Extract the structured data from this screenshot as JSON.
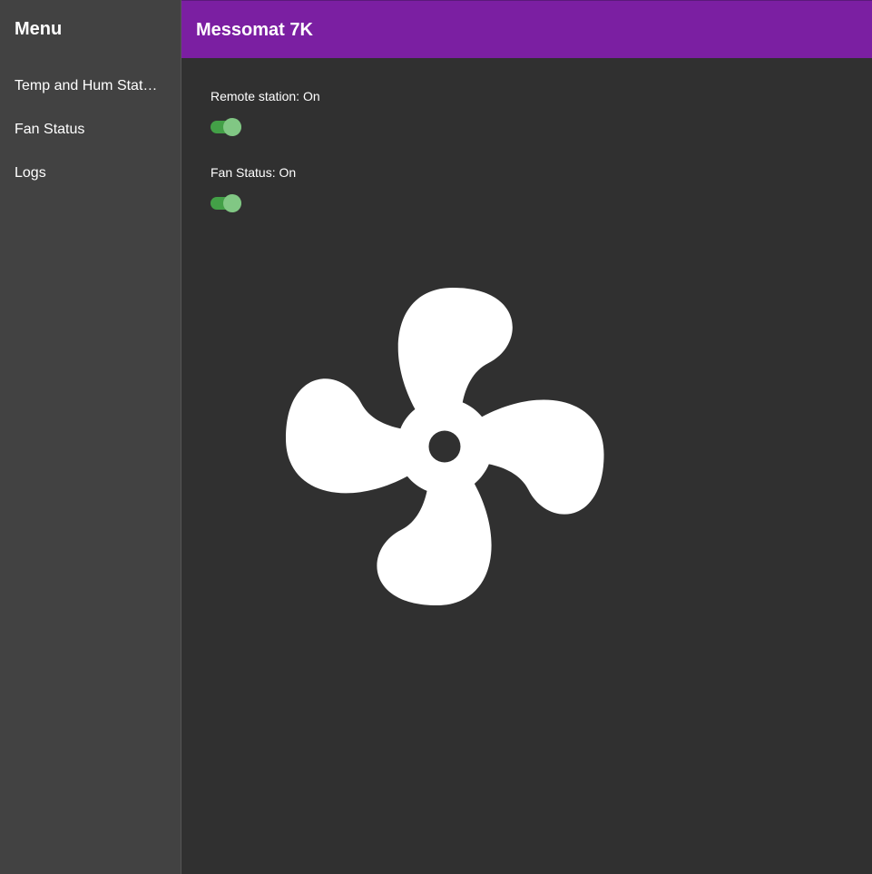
{
  "sidebar": {
    "title": "Menu",
    "items": [
      {
        "label": "Temp and Hum Stat…"
      },
      {
        "label": "Fan Status"
      },
      {
        "label": "Logs"
      }
    ]
  },
  "header": {
    "title": "Messomat 7K"
  },
  "main": {
    "remote_station": {
      "label": "Remote station: On",
      "on": true
    },
    "fan_status": {
      "label": "Fan Status: On",
      "on": true
    },
    "fan_icon": "fan-icon"
  },
  "colors": {
    "accent": "#7b1fa2",
    "toggle_track": "#43a047",
    "toggle_thumb": "#81c784",
    "icon": "#ffffff"
  }
}
